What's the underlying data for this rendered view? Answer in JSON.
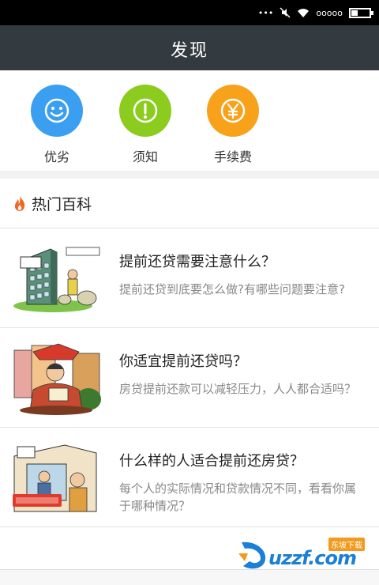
{
  "status_bar": {
    "dots": "•••",
    "carrier_dots": "ooooo"
  },
  "header": {
    "title": "发现"
  },
  "shortcuts": [
    {
      "label": "优劣",
      "icon": "smile-icon",
      "color": "#3a9ff0"
    },
    {
      "label": "须知",
      "icon": "exclamation-icon",
      "color": "#8ccc1e"
    },
    {
      "label": "手续费",
      "icon": "yuan-icon",
      "color": "#f8a21b"
    }
  ],
  "hot_section": {
    "title": "热门百科",
    "icon": "flame-icon",
    "icon_color": "#f26522"
  },
  "articles": [
    {
      "title": "提前还贷需要注意什么？",
      "description": "提前还贷到底要怎么做?有哪些问题要注意?"
    },
    {
      "title": "你适宜提前还贷吗？",
      "description": "房贷提前还款可以减轻压力，人人都合适吗？"
    },
    {
      "title": "什么样的人适合提前还房贷？",
      "description": "每个人的实际情况和贷款情况不同，看看你属于哪种情况？"
    }
  ],
  "watermark": {
    "text": "uzzf.com",
    "badge": "东坡下载"
  }
}
